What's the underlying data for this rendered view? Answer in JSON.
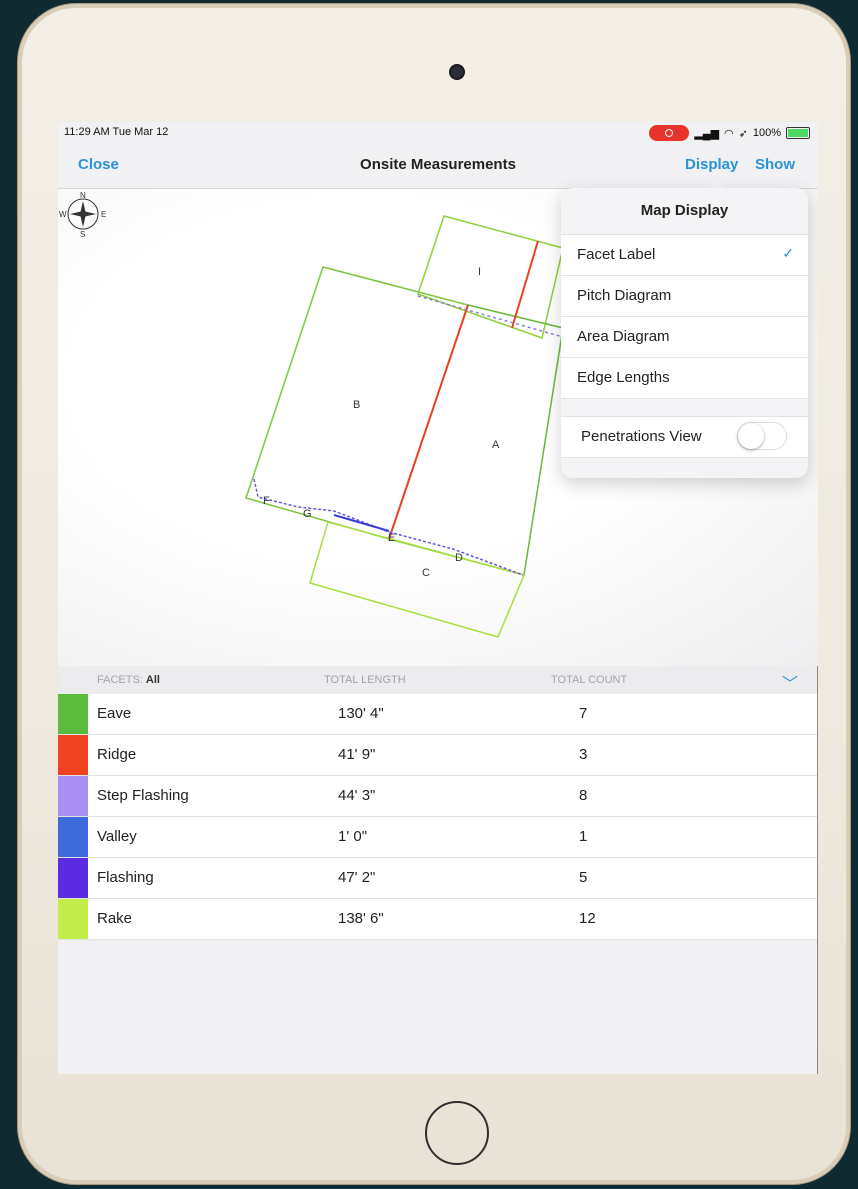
{
  "status_bar": {
    "time": "11:29 AM  Tue Mar 12",
    "battery": "100%"
  },
  "nav": {
    "close": "Close",
    "title": "Onsite Measurements",
    "display": "Display",
    "show": "Show"
  },
  "map": {
    "facet_labels": [
      "I",
      "B",
      "A",
      "C",
      "F",
      "G",
      "E",
      "D"
    ],
    "compass": {
      "n": "N",
      "s": "S",
      "e": "E",
      "w": "W"
    }
  },
  "popover": {
    "title": "Map Display",
    "items": [
      {
        "label": "Facet Label",
        "checked": true
      },
      {
        "label": "Pitch Diagram",
        "checked": false
      },
      {
        "label": "Area Diagram",
        "checked": false
      },
      {
        "label": "Edge Lengths",
        "checked": false
      }
    ],
    "toggle": {
      "label": "Penetrations View",
      "on": false
    }
  },
  "table": {
    "facets_label": "FACETS:",
    "facets_value": "All",
    "col_length": "TOTAL LENGTH",
    "col_count": "TOTAL COUNT",
    "rows": [
      {
        "name": "Eave",
        "length": "130' 4\"",
        "count": "7",
        "color": "#5bbb3c"
      },
      {
        "name": "Ridge",
        "length": "41' 9\"",
        "count": "3",
        "color": "#f04322"
      },
      {
        "name": "Step Flashing",
        "length": "44' 3\"",
        "count": "8",
        "color": "#a98ff2"
      },
      {
        "name": "Valley",
        "length": "1' 0\"",
        "count": "1",
        "color": "#3e6bdc"
      },
      {
        "name": "Flashing",
        "length": "47' 2\"",
        "count": "5",
        "color": "#5a2be0"
      },
      {
        "name": "Rake",
        "length": "138' 6\"",
        "count": "12",
        "color": "#c2ec4a"
      }
    ]
  }
}
